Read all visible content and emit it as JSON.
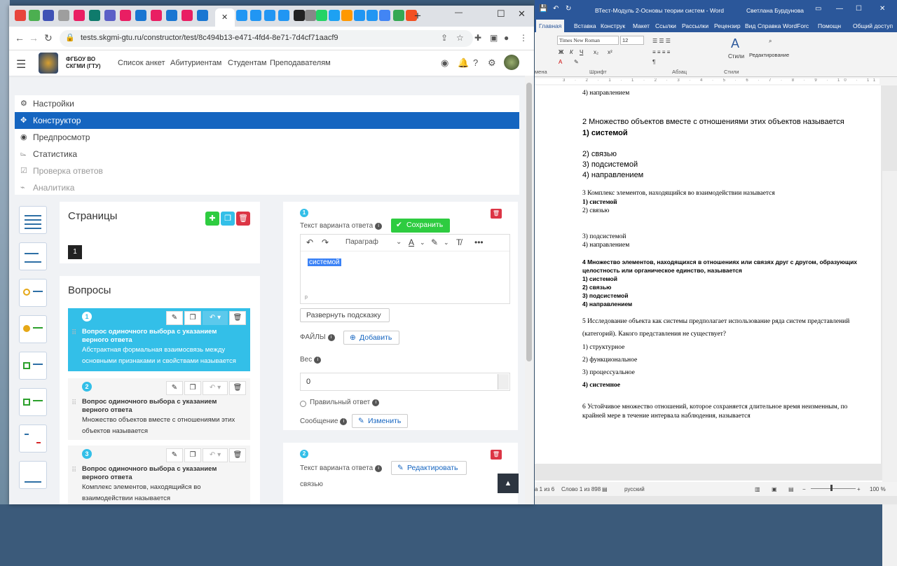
{
  "browser": {
    "url": "tests.skgmi-gtu.ru/constructor/test/8c494b13-e471-4fd4-8e71-7d4cf71aacf9",
    "new_tab": "+",
    "minimize": "—",
    "maximize": "☐",
    "close": "✕"
  },
  "app": {
    "org_line1": "ФГБОУ ВО",
    "org_line2": "СКГМИ (ГТУ)",
    "nav": [
      "Список анкет",
      "Абитуриентам",
      "Студентам",
      "Преподавателям"
    ]
  },
  "menu": {
    "items": [
      {
        "label": "Настройки",
        "icon": "gear-icon"
      },
      {
        "label": "Конструктор",
        "icon": "tools-icon"
      },
      {
        "label": "Предпросмотр",
        "icon": "eye-icon"
      },
      {
        "label": "Статистика",
        "icon": "chart-icon"
      },
      {
        "label": "Проверка ответов",
        "icon": "check-icon"
      },
      {
        "label": "Аналитика",
        "icon": "analytics-icon"
      }
    ]
  },
  "pages": {
    "title": "Страницы",
    "current": "1"
  },
  "questions": {
    "title": "Вопросы",
    "items": [
      {
        "num": "1",
        "type": "Вопрос одиночного выбора с указанием верного ответа",
        "text": "Абстрактная формальная взаимосвязь между основными признаками и свойствами называется"
      },
      {
        "num": "2",
        "type": "Вопрос одиночного выбора с указанием верного ответа",
        "text": "Множество объектов вместе с отношениями этих объектов называется"
      },
      {
        "num": "3",
        "type": "Вопрос одиночного выбора с указанием верного ответа",
        "text": "Комплекс элементов, находящийся во взаимодействии называется"
      }
    ]
  },
  "answer1": {
    "num": "1",
    "label": "Текст варианта ответа",
    "save": "Сохранить",
    "paragraph": "Параграф",
    "text": "системой",
    "p_tag": "p",
    "hint_btn": "Развернуть подсказку",
    "files_label": "ФАЙЛЫ",
    "add_btn": "Добавить",
    "weight_label": "Вес",
    "weight_value": "0",
    "correct_label": "Правильный ответ",
    "message_label": "Сообщение",
    "change_btn": "Изменить"
  },
  "answer2": {
    "num": "2",
    "label": "Текст варианта ответа",
    "edit_btn": "Редактировать",
    "text": "связью"
  },
  "word": {
    "title": "ВТест-Модуль 2-Основы теории систем  -  Word",
    "user": "Светлана Бурдунова",
    "tabs": [
      "Главная",
      "Вставка",
      "Конструк",
      "Макет",
      "Ссылки",
      "Рассылки",
      "Рецензир",
      "Вид",
      "Справка",
      "WordForc",
      "Помощн",
      "Общий доступ"
    ],
    "font": "Times New Roman",
    "size": "12",
    "groups": {
      "font": "Шрифт",
      "para": "Абзац",
      "styles": "Стили",
      "styles_btn": "Стили",
      "edit": "Редактирование",
      "clip": "мена"
    },
    "ruler": "3 · 2 · 1 · 1 · 2 · 3 · 4 · 5 · 6 · 7 · 8 · 9 · 10 · 11 · 12 · 13 · 14 · 15 · 16",
    "doc": [
      {
        "t": "4) направлением",
        "s": "ser"
      },
      {
        "t": "2 Множество объектов вместе с отношениями этих объектов называется",
        "s": "san"
      },
      {
        "t": "1) системой",
        "s": "san bold"
      },
      {
        "t": "2) связью",
        "s": "san"
      },
      {
        "t": "3) подсистемой",
        "s": "san"
      },
      {
        "t": "4) направлением",
        "s": "san"
      },
      {
        "t": "3 Комплекс элементов, находящийся во взаимодействии называется",
        "s": "ser"
      },
      {
        "t": "1) системой",
        "s": "ser bold"
      },
      {
        "t": "2) связью",
        "s": "ser"
      },
      {
        "t": "3) подсистемой",
        "s": "ser"
      },
      {
        "t": "4) направлением",
        "s": "ser"
      },
      {
        "t": "4 Множество элементов, находящихся в отношениях или связях друг с другом, образующих",
        "s": "sb"
      },
      {
        "t": "целостность или органическое единство, называется",
        "s": "sb"
      },
      {
        "t": "1) системой",
        "s": "sb"
      },
      {
        "t": "2) связью",
        "s": "sb"
      },
      {
        "t": "3) подсистемой",
        "s": "sb"
      },
      {
        "t": "4) направлением",
        "s": "sb"
      },
      {
        "t": "5 Исследование объекта как системы предполагает использование ряда систем представлений",
        "s": "ser"
      },
      {
        "t": "(категорий). Какого представления не существует?",
        "s": "ser"
      },
      {
        "t": "1) структурное",
        "s": "ser"
      },
      {
        "t": "2) функциональное",
        "s": "ser"
      },
      {
        "t": "3) процессуальное",
        "s": "ser"
      },
      {
        "t": "4) системное",
        "s": "ser bold"
      },
      {
        "t": "6 Устойчивое множество отношений, которое сохраняется длительное время неизменным, по",
        "s": "ser"
      },
      {
        "t": "крайней мере в течение интервала наблюдения, называется",
        "s": "ser"
      }
    ],
    "status_page": "а 1 из 6",
    "status_words": "Слово 1 из 898",
    "status_lang": "русский",
    "zoom": "100 %"
  }
}
